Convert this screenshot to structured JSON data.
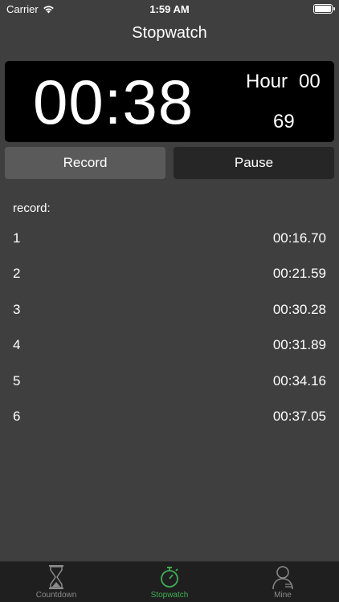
{
  "status": {
    "carrier": "Carrier",
    "time": "1:59 AM"
  },
  "nav": {
    "title": "Stopwatch"
  },
  "timer": {
    "main": "00:38",
    "hour_label": "Hour",
    "hour_value": "00",
    "centiseconds": "69"
  },
  "buttons": {
    "record": "Record",
    "pause": "Pause"
  },
  "records": {
    "heading": "record:",
    "items": [
      {
        "index": "1",
        "time": "00:16.70"
      },
      {
        "index": "2",
        "time": "00:21.59"
      },
      {
        "index": "3",
        "time": "00:30.28"
      },
      {
        "index": "4",
        "time": "00:31.89"
      },
      {
        "index": "5",
        "time": "00:34.16"
      },
      {
        "index": "6",
        "time": "00:37.05"
      }
    ]
  },
  "tabs": [
    {
      "label": "Countdown",
      "icon": "hourglass-icon"
    },
    {
      "label": "Stopwatch",
      "icon": "stopwatch-icon",
      "selected": true
    },
    {
      "label": "Mine",
      "icon": "person-icon"
    }
  ],
  "colors": {
    "background": "#3f3f3f",
    "panel": "#000000",
    "accent": "#3fae55",
    "tab_inactive": "#8b8b8b"
  }
}
